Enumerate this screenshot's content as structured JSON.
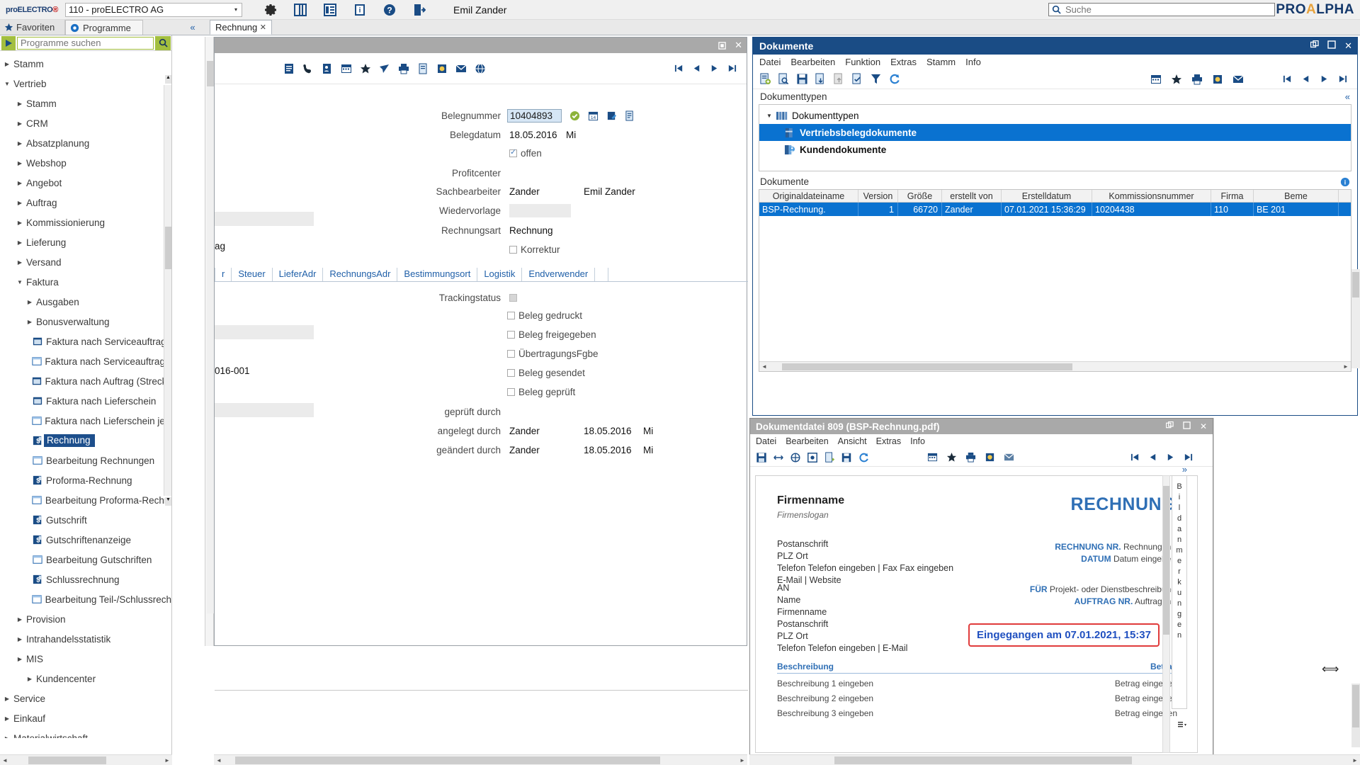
{
  "topbar": {
    "logo_part1": "proELECTRO",
    "logo_part2": "®",
    "company": "110 - proELECTRO AG",
    "user": "Emil Zander",
    "search_placeholder": "Suche",
    "search_value": "",
    "suite_logo_a": "PRO",
    "suite_logo_b": "A",
    "suite_logo_c": "LPHA",
    "icons": [
      "gear-icon",
      "panel-icon",
      "list-icon",
      "info-book-icon",
      "help-icon",
      "logout-icon"
    ]
  },
  "tabstrip": {
    "favorites": "Favoriten",
    "programs": "Programme",
    "collapse": "«",
    "doc_tab": "Rechnung",
    "doc_tab_close": "✕"
  },
  "leftnav": {
    "search_placeholder": "Programme suchen",
    "search_value": "",
    "tree": [
      {
        "label": "Stamm",
        "level": 1,
        "expanded": false,
        "icon": "",
        "selected": false
      },
      {
        "label": "Vertrieb",
        "level": 1,
        "expanded": true,
        "icon": "",
        "selected": false
      },
      {
        "label": "Stamm",
        "level": 2,
        "expanded": false,
        "icon": "",
        "selected": false
      },
      {
        "label": "CRM",
        "level": 2,
        "expanded": false,
        "icon": "",
        "selected": false
      },
      {
        "label": "Absatzplanung",
        "level": 2,
        "expanded": false,
        "icon": "",
        "selected": false
      },
      {
        "label": "Webshop",
        "level": 2,
        "expanded": false,
        "icon": "",
        "selected": false
      },
      {
        "label": "Angebot",
        "level": 2,
        "expanded": false,
        "icon": "",
        "selected": false
      },
      {
        "label": "Auftrag",
        "level": 2,
        "expanded": false,
        "icon": "",
        "selected": false
      },
      {
        "label": "Kommissionierung",
        "level": 2,
        "expanded": false,
        "icon": "",
        "selected": false
      },
      {
        "label": "Lieferung",
        "level": 2,
        "expanded": false,
        "icon": "",
        "selected": false
      },
      {
        "label": "Versand",
        "level": 2,
        "expanded": false,
        "icon": "",
        "selected": false
      },
      {
        "label": "Faktura",
        "level": 2,
        "expanded": true,
        "icon": "",
        "selected": false
      },
      {
        "label": "Ausgaben",
        "level": 3,
        "expanded": false,
        "icon": "",
        "selected": false
      },
      {
        "label": "Bonusverwaltung",
        "level": 3,
        "expanded": false,
        "icon": "",
        "selected": false
      },
      {
        "label": "Faktura nach Serviceauftrag",
        "level": 4,
        "icon": "window-blue-icon",
        "selected": false
      },
      {
        "label": "Faktura nach Serviceauftrag je K",
        "level": 4,
        "icon": "window-icon",
        "selected": false
      },
      {
        "label": "Faktura nach Auftrag (Streckeng",
        "level": 4,
        "icon": "window-blue-icon",
        "selected": false
      },
      {
        "label": "Faktura nach Lieferschein",
        "level": 4,
        "icon": "window-blue-icon",
        "selected": false
      },
      {
        "label": "Faktura nach Lieferschein je Kun",
        "level": 4,
        "icon": "window-icon",
        "selected": false
      },
      {
        "label": "Rechnung",
        "level": 4,
        "icon": "dollar-doc-icon",
        "selected": true
      },
      {
        "label": "Bearbeitung Rechnungen",
        "level": 4,
        "icon": "window-icon",
        "selected": false
      },
      {
        "label": "Proforma-Rechnung",
        "level": 4,
        "icon": "dollar-doc-icon",
        "selected": false
      },
      {
        "label": "Bearbeitung Proforma-Rechnun",
        "level": 4,
        "icon": "window-icon",
        "selected": false
      },
      {
        "label": "Gutschrift",
        "level": 4,
        "icon": "dollar-doc-icon",
        "selected": false
      },
      {
        "label": "Gutschriftenanzeige",
        "level": 4,
        "icon": "dollar-doc-icon",
        "selected": false
      },
      {
        "label": "Bearbeitung Gutschriften",
        "level": 4,
        "icon": "window-icon",
        "selected": false
      },
      {
        "label": "Schlussrechnung",
        "level": 4,
        "icon": "dollar-doc-icon",
        "selected": false
      },
      {
        "label": "Bearbeitung Teil-/Schlussrechnu",
        "level": 4,
        "icon": "window-icon",
        "selected": false
      },
      {
        "label": "Provision",
        "level": 2,
        "expanded": false,
        "icon": "",
        "selected": false
      },
      {
        "label": "Intrahandelsstatistik",
        "level": 2,
        "expanded": false,
        "icon": "",
        "selected": false
      },
      {
        "label": "MIS",
        "level": 2,
        "expanded": false,
        "icon": "",
        "selected": false
      },
      {
        "label": "Kundencenter",
        "level": 3,
        "icon": "dollar-doc-icon",
        "selected": false
      },
      {
        "label": "Service",
        "level": 1,
        "expanded": false,
        "icon": "",
        "selected": false
      },
      {
        "label": "Einkauf",
        "level": 1,
        "expanded": false,
        "icon": "",
        "selected": false
      },
      {
        "label": "Materialwirtschaft",
        "level": 1,
        "expanded": false,
        "icon": "",
        "selected": false
      }
    ]
  },
  "mainform": {
    "window_buttons": [
      "restore-icon",
      "close-icon"
    ],
    "toolbar_icons": [
      "notes-icon",
      "phone-icon",
      "contact-icon",
      "calendar-icon",
      "star-icon",
      "send-icon",
      "print-icon",
      "document-icon",
      "attach-icon",
      "mail-icon",
      "globe-icon"
    ],
    "nav_icons": [
      "first-record-icon",
      "prev-record-icon",
      "next-record-icon",
      "last-record-icon"
    ],
    "fields": {
      "belegnummer_label": "Belegnummer",
      "belegnummer_value": "10404893",
      "belegdatum_label": "Belegdatum",
      "belegdatum_value": "18.05.2016",
      "belegdatum_day": "Mi",
      "offen_label": "offen",
      "offen_checked": true,
      "profitcenter_label": "Profitcenter",
      "profitcenter_value": "",
      "sachbearbeiter_label": "Sachbearbeiter",
      "sachbearbeiter_value": "Zander",
      "sachbearbeiter_name": "Emil Zander",
      "wiedervorlage_label": "Wiedervorlage",
      "wiedervorlage_value": "",
      "rechnungsart_label": "Rechnungsart",
      "rechnungsart_value": "Rechnung",
      "korrektur_label": "Korrektur",
      "korrektur_checked": false,
      "trackingstatus_label": "Trackingstatus",
      "beleg_gedruckt": "Beleg gedruckt",
      "beleg_freigegeben": "Beleg freigegeben",
      "uebertragungsfgbe": "ÜbertragungsFgbe",
      "beleg_gesendet": "Beleg gesendet",
      "beleg_geprueft": "Beleg geprüft",
      "geprueft_durch_label": "geprüft durch",
      "geprueft_durch_value": "",
      "angelegt_durch_label": "angelegt durch",
      "angelegt_durch_value": "Zander",
      "angelegt_durch_date": "18.05.2016",
      "angelegt_durch_day": "Mi",
      "geaendert_durch_label": "geändert durch",
      "geaendert_durch_value": "Zander",
      "geaendert_durch_date": "18.05.2016",
      "geaendert_durch_day": "Mi",
      "partial_left_1": "ag",
      "partial_left_2": "016-001",
      "partial_tab_left": "r"
    },
    "tabs": [
      "Steuer",
      "LieferAdr",
      "RechnungsAdr",
      "Bestimmungsort",
      "Logistik",
      "Endverwender"
    ],
    "field_icons": [
      "check-green-icon",
      "calendar-blue-icon",
      "edit-doc-icon",
      "list-doc-icon"
    ]
  },
  "dokumente": {
    "title": "Dokumente",
    "window_buttons": [
      "restore-down-icon",
      "maximize-icon",
      "close-icon"
    ],
    "menu": [
      "Datei",
      "Bearbeiten",
      "Funktion",
      "Extras",
      "Stamm",
      "Info"
    ],
    "toolbar_icons": [
      "new-doc-icon",
      "view-doc-icon",
      "save-icon",
      "import-doc-icon",
      "export-doc-icon",
      "check-doc-icon",
      "filter-icon",
      "refresh-icon"
    ],
    "right_icons": [
      "calendar-icon",
      "star-icon",
      "print-icon",
      "attach-icon",
      "mail-icon"
    ],
    "nav_icons": [
      "first-record-icon",
      "prev-record-icon",
      "next-record-icon",
      "last-record-icon"
    ],
    "types_section_label": "Dokumenttypen",
    "types_collapse": "«",
    "types_tree": [
      {
        "label": "Dokumenttypen",
        "root": true,
        "icon": "folders-icon",
        "selected": false
      },
      {
        "label": "Vertriebsbelegdokumente",
        "root": false,
        "icon": "binder-icon",
        "selected": true
      },
      {
        "label": "Kundendokumente",
        "root": false,
        "icon": "customer-doc-icon",
        "selected": false
      }
    ],
    "docs_section_label": "Dokumente",
    "docs_info_icon": "info-icon",
    "table": {
      "columns": [
        "Originaldateiname",
        "Version",
        "Größe",
        "erstellt von",
        "Erstelldatum",
        "Kommissionsnummer",
        "Firma",
        "Beme"
      ],
      "rows": [
        {
          "Originaldateiname": "BSP-Rechnung.",
          "Version": "1",
          "Größe": "66720",
          "erstellt von": "Zander",
          "Erstelldatum": "07.01.2021 15:36:29",
          "Kommissionsnummer": "10204438",
          "Firma": "110",
          "Beme": "BE 201"
        }
      ]
    }
  },
  "pdfviewer": {
    "title": "Dokumentdatei 809 (BSP-Rechnung.pdf)",
    "window_buttons": [
      "restore-down-icon",
      "maximize-icon",
      "close-icon"
    ],
    "menu": [
      "Datei",
      "Bearbeiten",
      "Ansicht",
      "Extras",
      "Info"
    ],
    "toolbar_icons": [
      "save-icon",
      "fit-width-icon",
      "fit-page-icon",
      "zoom-icon",
      "export-icon",
      "save-as-icon",
      "refresh-icon"
    ],
    "mid_icons": [
      "calendar-icon",
      "star-icon",
      "print-icon",
      "attach-icon",
      "mail-icon"
    ],
    "nav_icons": [
      "first-page-icon",
      "prev-page-icon",
      "next-page-icon",
      "last-page-icon"
    ],
    "expand_chevron": "»",
    "annotations_label": "Bildanmerkungen",
    "document": {
      "company_name": "Firmenname",
      "company_slogan": "Firmenslogan",
      "doc_title": "RECHNUNG",
      "address_lines": [
        "Postanschrift",
        "PLZ Ort",
        "Telefon Telefon eingeben | Fax Fax eingeben",
        "E-Mail | Website"
      ],
      "recipient_lines": [
        "AN",
        "Name",
        "Firmenname",
        "Postanschrift",
        "PLZ Ort",
        "Telefon Telefon eingeben | E-Mail"
      ],
      "meta_right": [
        {
          "label": "RECHNUNG NR.",
          "value": "Rechnungsnr."
        },
        {
          "label": "DATUM",
          "value": "Datum eingeben"
        }
      ],
      "meta_right2": [
        {
          "label": "FÜR",
          "value": "Projekt- oder Dienstbeschreibung"
        },
        {
          "label": "AUFTRAG NR.",
          "value": "Auftragsnr."
        }
      ],
      "stamp": "Eingegangen am 07.01.2021, 15:37",
      "table_header": {
        "desc": "Beschreibung",
        "amount": "Betrag"
      },
      "table_rows": [
        {
          "desc": "Beschreibung 1 eingeben",
          "amount": "Betrag eingeben"
        },
        {
          "desc": "Beschreibung 2 eingeben",
          "amount": "Betrag eingeben"
        },
        {
          "desc": "Beschreibung 3 eingeben",
          "amount": "Betrag eingeben"
        }
      ]
    }
  },
  "colors": {
    "accent_blue": "#1a4c85",
    "selection_blue": "#0a72d0",
    "green_accent": "#a3bf3f",
    "title_grey": "#a9a9a9",
    "stamp_red": "#e03b3b",
    "stamp_blue": "#2050c0"
  }
}
